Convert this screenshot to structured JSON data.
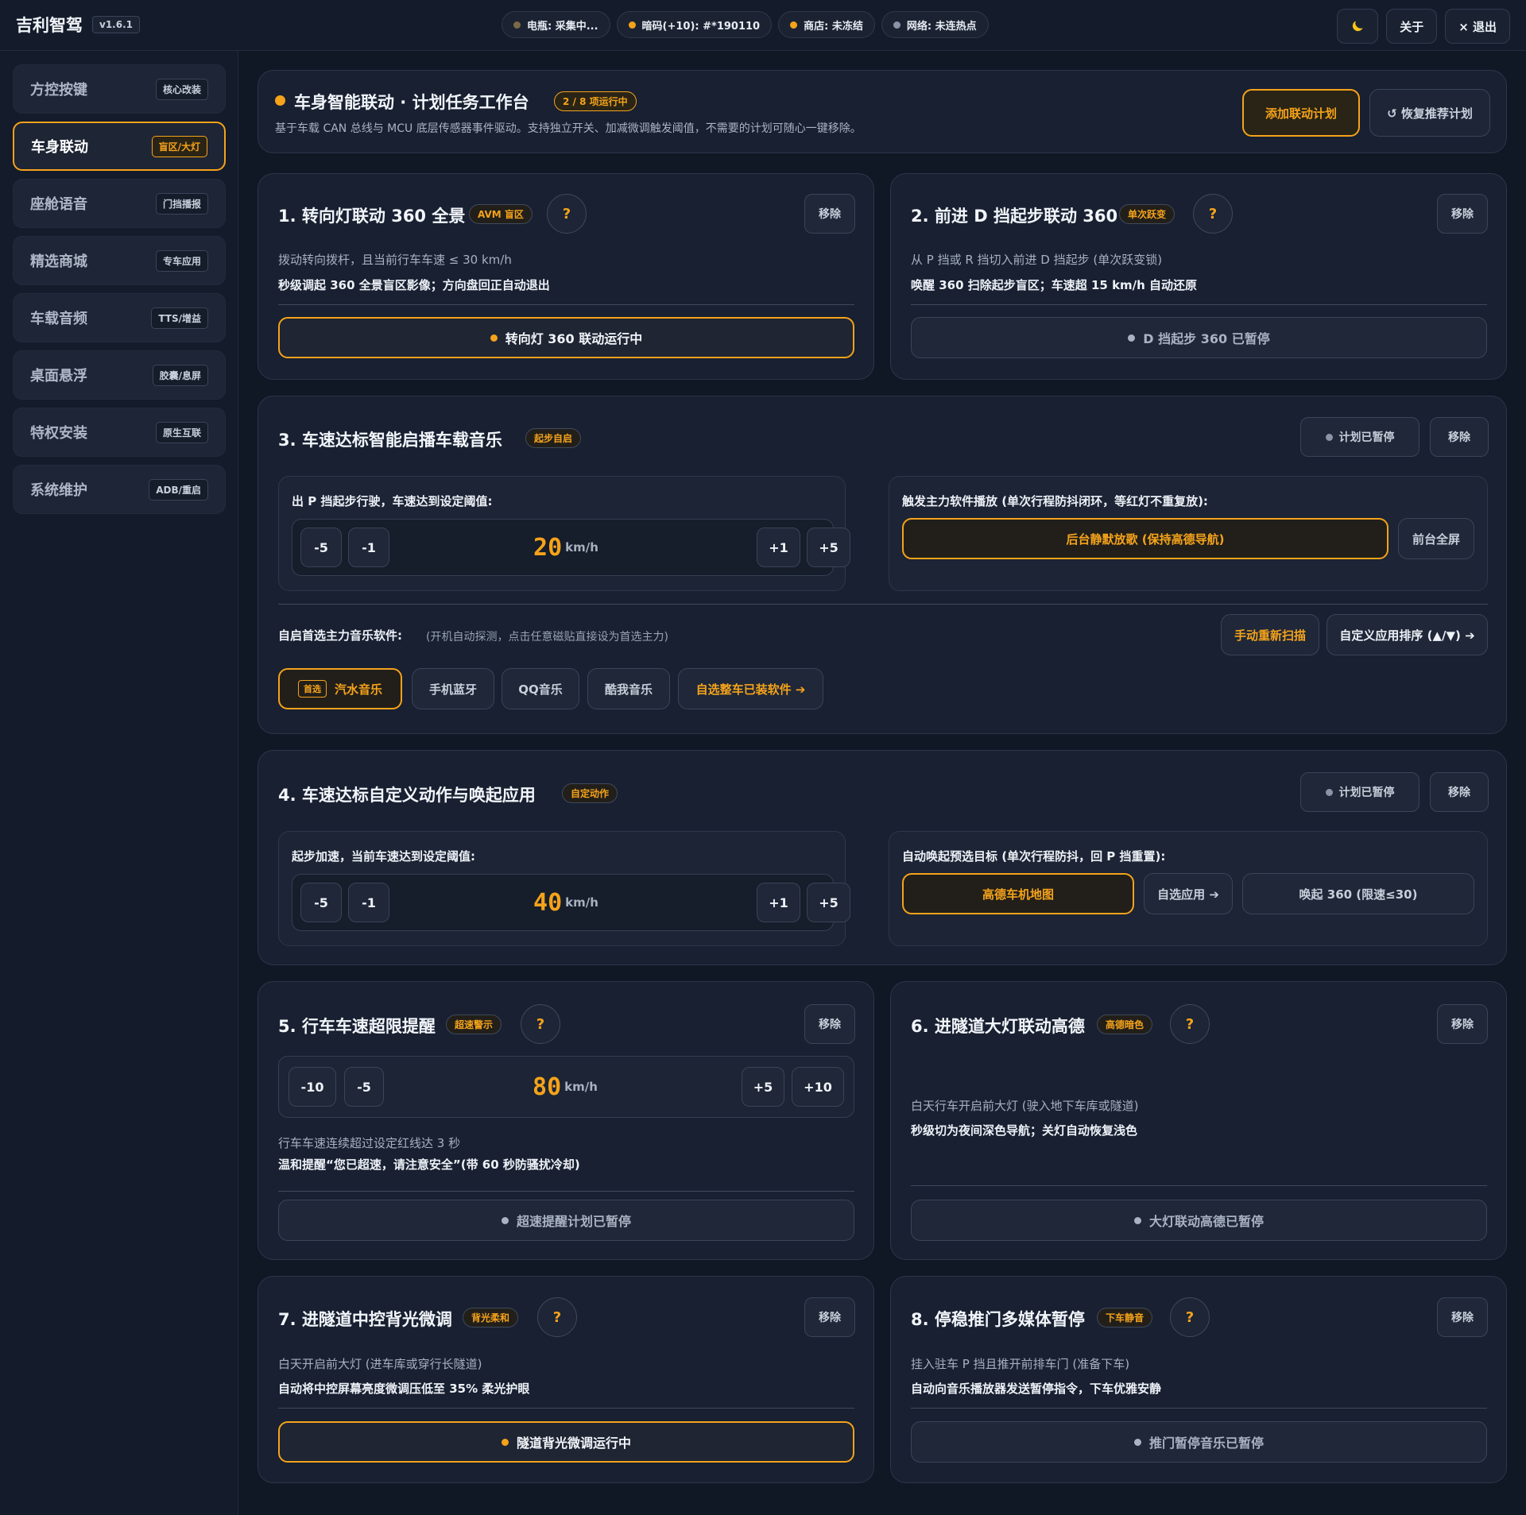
{
  "app": {
    "title": "吉利智驾",
    "version": "v1.6.1"
  },
  "status": [
    {
      "label": "电瓶: 采集中...",
      "state": "dim"
    },
    {
      "label": "暗码(+10): #*190110",
      "state": "on"
    },
    {
      "label": "商店: 未冻结",
      "state": "on"
    },
    {
      "label": "网络: 未连热点",
      "state": "off"
    }
  ],
  "top_actions": {
    "about": "关于",
    "exit": "× 退出"
  },
  "sidebar": [
    {
      "label": "方控按键",
      "badge": "核心改装"
    },
    {
      "label": "车身联动",
      "badge": "盲区/大灯",
      "active": true
    },
    {
      "label": "座舱语音",
      "badge": "门挡播报"
    },
    {
      "label": "精选商城",
      "badge": "专车应用"
    },
    {
      "label": "车载音频",
      "badge": "TTS/增益"
    },
    {
      "label": "桌面悬浮",
      "badge": "胶囊/息屏"
    },
    {
      "label": "特权安装",
      "badge": "原生互联"
    },
    {
      "label": "系统维护",
      "badge": "ADB/重启"
    }
  ],
  "hero": {
    "title": "车身智能联动 · 计划任务工作台",
    "badge": "2 / 8 项运行中",
    "subtitle": "基于车载 CAN 总线与 MCU 底层传感器事件驱动。支持独立开关、加减微调触发阈值，不需要的计划可随心一键移除。",
    "add_button": "添加联动计划",
    "reset_button": "↺ 恢复推荐计划"
  },
  "common": {
    "remove": "移除",
    "help": "?",
    "plan_paused": "计划已暂停"
  },
  "cards": {
    "c1": {
      "title": "1. 转向灯联动 360 全景",
      "tag": "AVM 盲区",
      "desc1": "拨动转向拨杆，且当前行车车速 ≤ 30 km/h",
      "desc2": "秒级调起 360 全景盲区影像；方向盘回正自动退出",
      "status": "转向灯 360 联动运行中"
    },
    "c2": {
      "title": "2. 前进 D 挡起步联动 360",
      "tag": "单次跃变",
      "desc1": "从 P 挡或 R 挡切入前进 D 挡起步 (单次跃变锁)",
      "desc2": "唤醒 360 扫除起步盲区；车速超 15 km/h 自动还原",
      "status": "D 挡起步 360 已暂停"
    },
    "c3": {
      "title": "3. 车速达标智能启播车载音乐",
      "tag": "起步自启",
      "left_label": "出 P 挡起步行驶，车速达到设定阈值:",
      "speed": "20",
      "unit": "km/h",
      "steps": [
        "-5",
        "-1",
        "+1",
        "+5"
      ],
      "right_label": "触发主力软件播放 (单次行程防抖闭环，等红灯不重复放):",
      "play_mode": "后台静默放歌 (保持高德导航)",
      "play_alt": "前台全屏",
      "pref_label": "自启首选主力音乐软件:",
      "pref_note": "(开机自动探测，点击任意磁贴直接设为首选主力)",
      "rescan": "手动重新扫描",
      "sort": "自定义应用排序 (▲/▼) ➔",
      "first_badge": "首选",
      "apps": [
        "汽水音乐",
        "手机蓝牙",
        "QQ音乐",
        "酷我音乐",
        "自选整车已装软件 ➔"
      ]
    },
    "c4": {
      "title": "4. 车速达标自定义动作与唤起应用",
      "tag": "自定动作",
      "left_label": "起步加速，当前车速达到设定阈值:",
      "speed": "40",
      "unit": "km/h",
      "steps": [
        "-5",
        "-1",
        "+1",
        "+5"
      ],
      "right_label": "自动唤起预选目标 (单次行程防抖，回 P 挡重置):",
      "targets": [
        "高德车机地图",
        "自选应用 ➔",
        "唤起 360 (限速≤30)"
      ]
    },
    "c5": {
      "title": "5. 行车车速超限提醒",
      "tag": "超速警示",
      "speed": "80",
      "unit": "km/h",
      "steps": [
        "-10",
        "-5",
        "+5",
        "+10"
      ],
      "desc1": "行车车速连续超过设定红线达 3 秒",
      "desc2": "温和提醒“您已超速，请注意安全”(带 60 秒防骚扰冷却)",
      "status": "超速提醒计划已暂停"
    },
    "c6": {
      "title": "6. 进隧道大灯联动高德",
      "tag": "高德暗色",
      "desc1": "白天行车开启前大灯 (驶入地下车库或隧道)",
      "desc2": "秒级切为夜间深色导航；关灯自动恢复浅色",
      "status": "大灯联动高德已暂停"
    },
    "c7": {
      "title": "7. 进隧道中控背光微调",
      "tag": "背光柔和",
      "desc1": "白天开启前大灯 (进车库或穿行长隧道)",
      "desc2": "自动将中控屏幕亮度微调压低至 35% 柔光护眼",
      "status": "隧道背光微调运行中"
    },
    "c8": {
      "title": "8. 停稳推门多媒体暂停",
      "tag": "下车静音",
      "desc1": "挂入驻车 P 挡且推开前排车门 (准备下车)",
      "desc2": "自动向音乐播放器发送暂停指令，下车优雅安静",
      "status": "推门暂停音乐已暂停"
    }
  },
  "colors": {
    "accent": "#f5a31a",
    "bg": "#101725",
    "card": "#182031"
  }
}
